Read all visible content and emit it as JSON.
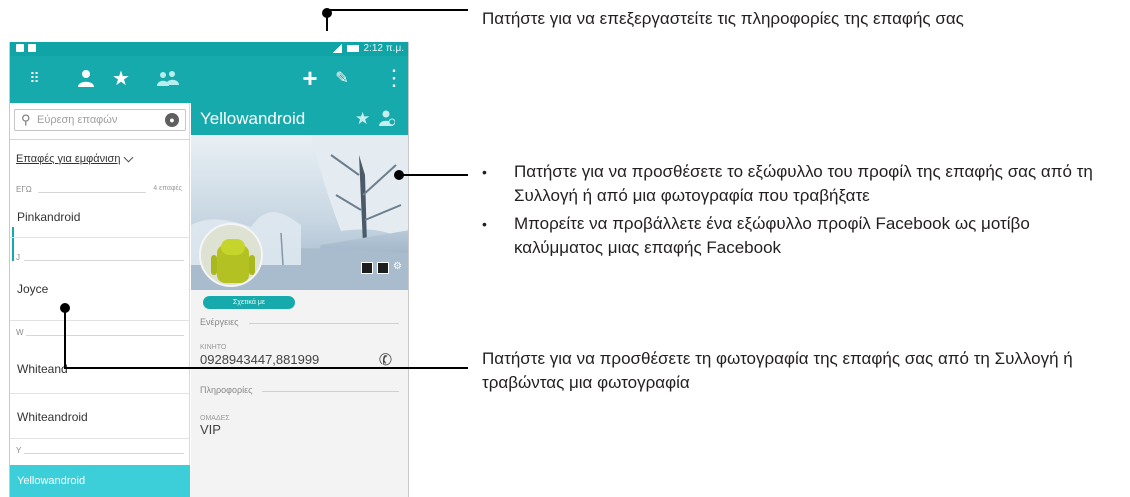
{
  "status_bar": {
    "time": "2:12 π.μ."
  },
  "action_bar": {
    "tabs": [
      {
        "name": "dialpad-tab"
      },
      {
        "name": "contacts-tab"
      },
      {
        "name": "favorites-tab"
      },
      {
        "name": "groups-tab"
      }
    ]
  },
  "search": {
    "placeholder": "Εύρεση επαφών"
  },
  "contacts_filter": "Επαφές για εμφάνιση",
  "list": {
    "section_me": {
      "label": "ΕΓΩ",
      "count": "4 επαφές"
    },
    "sections": [
      {
        "letter": "J"
      },
      {
        "letter": "W"
      },
      {
        "letter": "Y"
      }
    ],
    "rows": [
      {
        "name": "Pinkandroid"
      },
      {
        "name": "Joyce"
      },
      {
        "name": "Whiteand"
      },
      {
        "name": "Whiteandroid"
      },
      {
        "name": "Yellowandroid"
      }
    ]
  },
  "detail": {
    "name": "Yellowandroid",
    "about_button": "Σχετικά με",
    "actions_title": "Ενέργειες",
    "phone_label": "ΚΙΝΗΤΟ",
    "phone_value": "0928943447,881999",
    "info_title": "Πληροφορίες",
    "groups_label": "ΟΜΑΔΕΣ",
    "groups_value": "VIP"
  },
  "callouts": {
    "top": "Πατήστε για να επεξεργαστείτε τις πληροφορίες της επαφής σας",
    "middle": [
      "Πατήστε για να προσθέσετε το εξώφυλλο του προφίλ της επαφής σας από τη Συλλογή ή από μια φωτογραφία που τραβήξατε",
      "Μπορείτε να προβάλλετε ένα εξώφυλλο προφίλ Facebook ως μοτίβο καλύμματος μιας επαφής Facebook"
    ],
    "bottom": "Πατήστε για να προσθέσετε τη φωτογραφία της επαφής σας από τη Συλλογή ή τραβώντας μια φωτογραφία"
  },
  "colors": {
    "accent": "#17aaac",
    "selected_row": "#3ccfd9"
  },
  "icons": [
    "dialpad-icon",
    "person-icon",
    "star-icon",
    "group-icon",
    "plus-icon",
    "edit-icon",
    "more-icon",
    "search-icon",
    "mic-icon",
    "phone-icon",
    "camera-icon"
  ]
}
